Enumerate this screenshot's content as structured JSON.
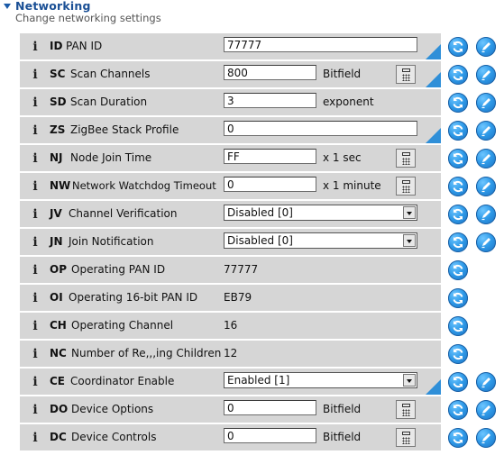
{
  "section": {
    "title": "Networking",
    "subtitle": "Change networking settings"
  },
  "icons": {
    "info": "i",
    "read": "refresh-icon",
    "write": "pencil-icon",
    "calculator": "calculator-icon"
  },
  "colors": {
    "row_bg": "#d6d6d6",
    "accent": "#2f8fd8",
    "title": "#1a4f95"
  },
  "rows": [
    {
      "code": "ID",
      "label": "PAN ID",
      "type": "text",
      "value": "77777"
    },
    {
      "code": "SC",
      "label": "Scan Channels",
      "type": "text",
      "value": "800",
      "unit": "Bitfield"
    },
    {
      "code": "SD",
      "label": "Scan Duration",
      "type": "text",
      "value": "3",
      "unit": "exponent"
    },
    {
      "code": "ZS",
      "label": "ZigBee Stack Profile",
      "type": "text",
      "value": "0"
    },
    {
      "code": "NJ",
      "label": "Node Join Time",
      "type": "text",
      "value": "FF",
      "unit": "x 1 sec"
    },
    {
      "code": "NW",
      "label": "Network Watchdog Timeout",
      "type": "text",
      "value": "0",
      "unit": "x 1 minute"
    },
    {
      "code": "JV",
      "label": "Channel Verification",
      "type": "select",
      "value": "Disabled [0]"
    },
    {
      "code": "JN",
      "label": "Join Notification",
      "type": "select",
      "value": "Disabled [0]"
    },
    {
      "code": "OP",
      "label": "Operating PAN ID",
      "type": "readonly",
      "value": "77777"
    },
    {
      "code": "OI",
      "label": "Operating 16-bit PAN ID",
      "type": "readonly",
      "value": "EB79"
    },
    {
      "code": "CH",
      "label": "Operating Channel",
      "type": "readonly",
      "value": "16"
    },
    {
      "code": "NC",
      "label": "Number of Re,,,ing Children",
      "type": "readonly",
      "value": "12"
    },
    {
      "code": "CE",
      "label": "Coordinator Enable",
      "type": "select",
      "value": "Enabled [1]"
    },
    {
      "code": "DO",
      "label": "Device Options",
      "type": "text",
      "value": "0",
      "unit": "Bitfield"
    },
    {
      "code": "DC",
      "label": "Device Controls",
      "type": "text",
      "value": "0",
      "unit": "Bitfield"
    }
  ]
}
